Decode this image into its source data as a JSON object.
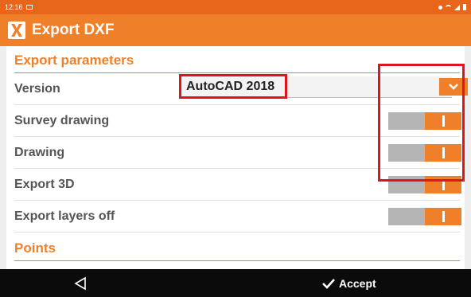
{
  "status_bar": {
    "time": "12:16"
  },
  "app_bar": {
    "title": "Export DXF",
    "logo_icon": "app-logo-icon"
  },
  "section_export": {
    "title": "Export parameters",
    "version": {
      "label": "Version",
      "value": "AutoCAD 2018"
    },
    "toggles": [
      {
        "label": "Survey drawing",
        "state": "on"
      },
      {
        "label": "Drawing",
        "state": "on"
      },
      {
        "label": "Export 3D",
        "state": "on"
      },
      {
        "label": "Export layers off",
        "state": "on"
      }
    ]
  },
  "section_points": {
    "title": "Points"
  },
  "nav": {
    "accept_label": "Accept"
  },
  "colors": {
    "accent": "#f07f2a",
    "status_bar": "#e8661c",
    "highlight": "#e1141b",
    "toggle_off": "#b5b5b5"
  }
}
